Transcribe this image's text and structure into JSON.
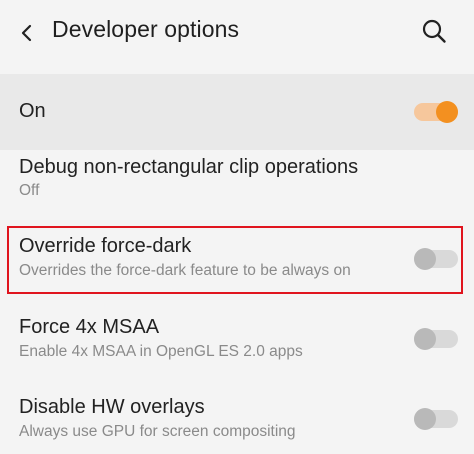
{
  "header": {
    "title": "Developer options"
  },
  "master": {
    "label": "On",
    "toggle_state": "on"
  },
  "settings": [
    {
      "title": "Debug non-rectangular clip operations",
      "subtitle": "Off"
    },
    {
      "title": "Override force-dark",
      "subtitle": "Overrides the force-dark feature to be always on",
      "toggle_state": "off",
      "highlighted": true
    },
    {
      "title": "Force 4x MSAA",
      "subtitle": "Enable 4x MSAA in OpenGL ES 2.0 apps",
      "toggle_state": "off"
    },
    {
      "title": "Disable HW overlays",
      "subtitle": "Always use GPU for screen compositing",
      "toggle_state": "off"
    }
  ],
  "colors": {
    "accent": "#f39020",
    "highlight": "#e0141e"
  },
  "icons": {
    "back": "chevron-left-icon",
    "search": "search-icon"
  }
}
